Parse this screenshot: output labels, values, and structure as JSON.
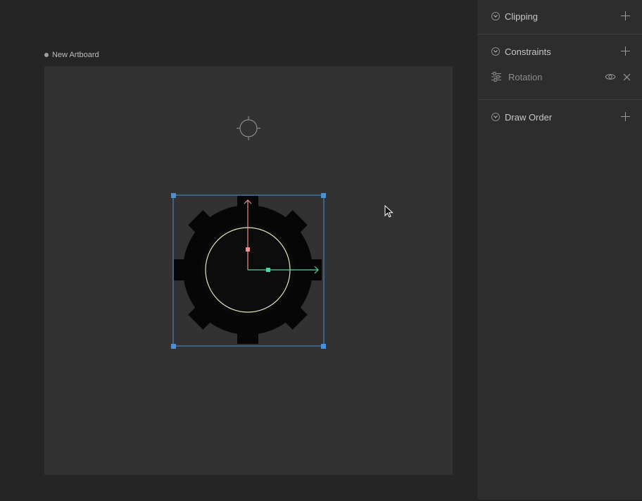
{
  "artboard": {
    "name": "New Artboard",
    "background": "#323232"
  },
  "canvas": {
    "object_icon": "gear-shape",
    "selection_color": "#4a90d9",
    "axis_x_color": "#4fd6a0",
    "axis_y_color": "#f09090"
  },
  "inspector": {
    "sections": [
      {
        "title": "Clipping"
      },
      {
        "title": "Constraints"
      },
      {
        "title": "Draw Order"
      }
    ],
    "constraints": [
      {
        "label": "Rotation",
        "icon": "sliders-icon"
      }
    ]
  }
}
